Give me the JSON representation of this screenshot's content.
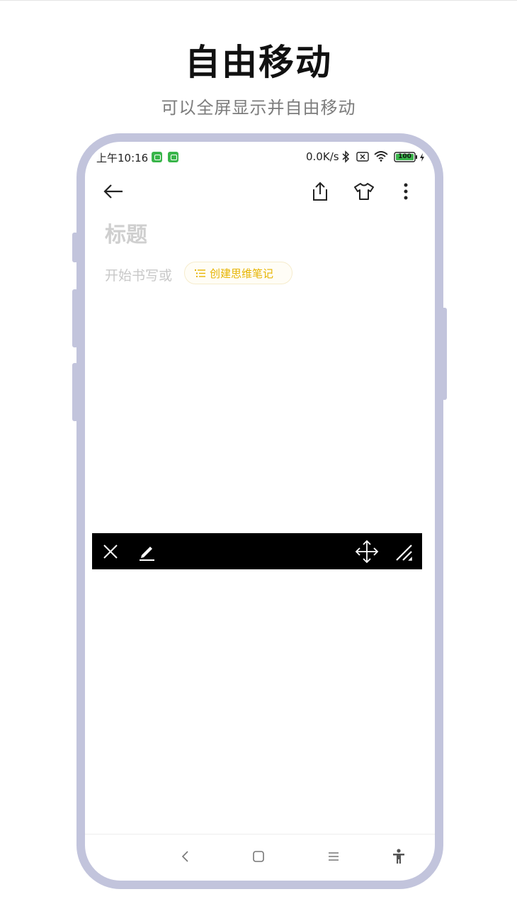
{
  "promo": {
    "headline": "自由移动",
    "subheadline": "可以全屏显示并自由移动"
  },
  "status_bar": {
    "time": "上午10:16",
    "network_speed": "0.0K/s",
    "battery": "100",
    "icons": [
      "app-notification-icon",
      "app-notification-icon",
      "bluetooth-icon",
      "sim-disabled-icon",
      "wifi-icon",
      "battery-icon",
      "charging-icon"
    ]
  },
  "editor": {
    "icons": [
      "back-arrow-icon",
      "share-icon",
      "theme-shirt-icon",
      "more-vertical-icon"
    ],
    "title_placeholder": "标题",
    "body_placeholder": "开始书写或",
    "mind_note_chip": {
      "icon": "list-icon",
      "label": "创建思维笔记"
    }
  },
  "floating_toolbar": {
    "icons": [
      "close-icon",
      "edit-pencil-icon",
      "move-icon",
      "resize-icon"
    ],
    "background": "#000000",
    "icon_color": "#ffffff"
  },
  "navigation_bar": {
    "icons": [
      "nav-back-icon",
      "nav-home-icon",
      "nav-menu-icon",
      "accessibility-icon"
    ]
  },
  "colors": {
    "frame": "#c2c4dc",
    "accent": "#e6b400",
    "status_app_icon": "#39b54a"
  }
}
